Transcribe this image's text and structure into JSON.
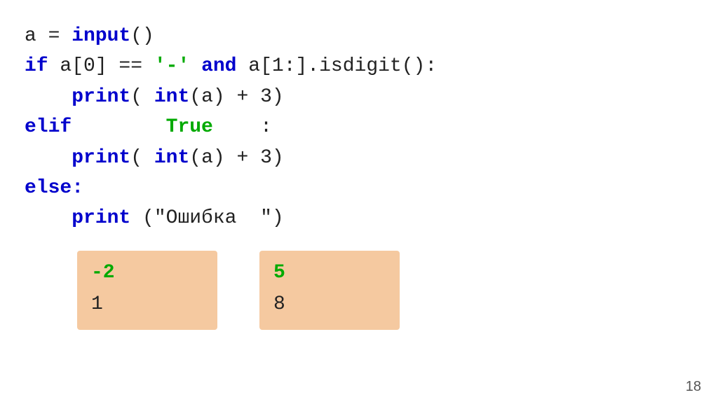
{
  "code": {
    "line1_pre": "a = ",
    "line1_func": "input",
    "line1_post": "()",
    "line2_kw1": "if",
    "line2_mid": " a[0] == ",
    "line2_str": "'-'",
    "line2_kw2": " and",
    "line2_post": " a[1:].isdigit():",
    "line3_pre": "    ",
    "line3_kw": "print",
    "line3_mid": "( ",
    "line3_kw2": "int",
    "line3_post": "(a) + 3)",
    "line4_kw": "elif",
    "line4_mid": "        ",
    "line4_val": "True",
    "line4_post": "    :",
    "line5_pre": "    ",
    "line5_kw": "print",
    "line5_mid": "( ",
    "line5_kw2": "int",
    "line5_post": "(a) + 3)",
    "line6_kw": "else:",
    "line7_pre": "    ",
    "line7_kw": "print",
    "line7_post": " (\"Ошибка  \")"
  },
  "boxes": [
    {
      "top": "-2",
      "bottom": "1"
    },
    {
      "top": "5",
      "bottom": "8"
    }
  ],
  "page_number": "18"
}
